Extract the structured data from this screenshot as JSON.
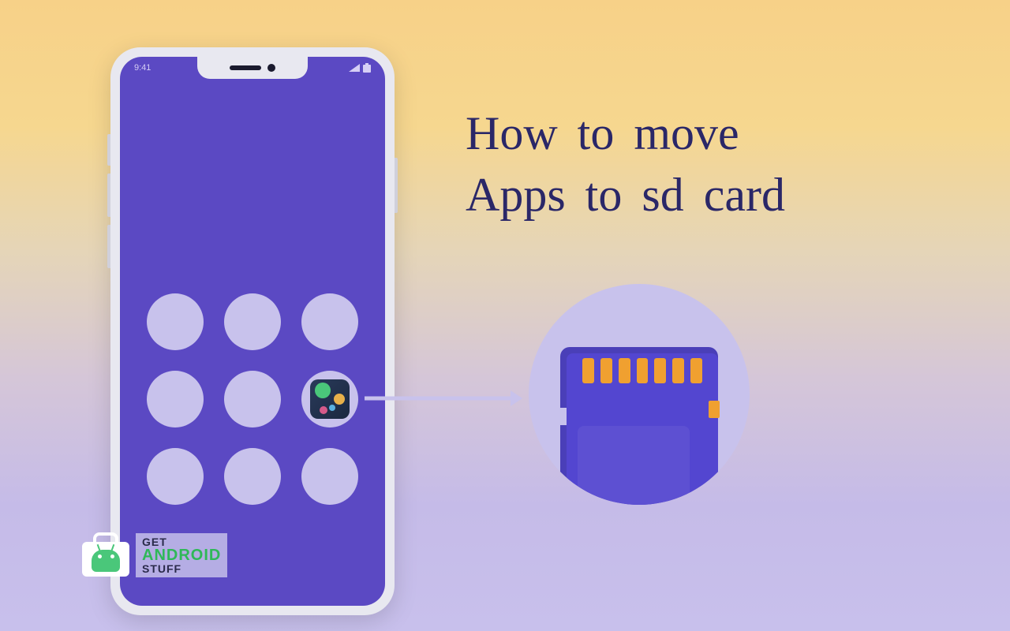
{
  "title": {
    "line1": "How to move",
    "line2": "Apps to sd card"
  },
  "phone": {
    "status_time": "9:41"
  },
  "watermark": {
    "line1": "GET",
    "line2": "ANDROID",
    "line3": "STUFF"
  },
  "icons": {
    "arrow": "arrow-right-icon",
    "sd": "sd-card-icon",
    "app": "planets-app-icon",
    "signal": "signal-icon",
    "battery": "battery-icon"
  }
}
